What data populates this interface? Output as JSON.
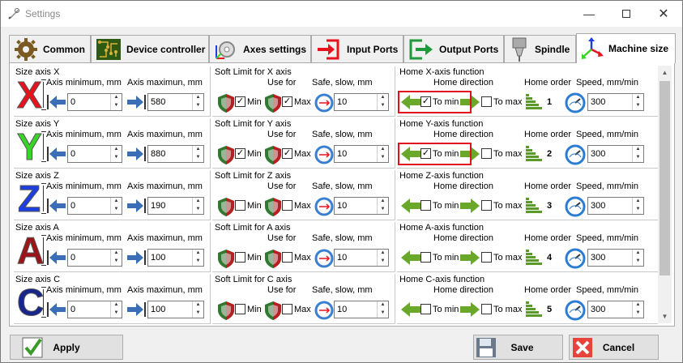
{
  "window": {
    "title": "Settings"
  },
  "tabs": [
    {
      "label": "Common"
    },
    {
      "label": "Device controller"
    },
    {
      "label": "Axes settings"
    },
    {
      "label": "Input Ports"
    },
    {
      "label": "Output Ports"
    },
    {
      "label": "Spindle"
    },
    {
      "label": "Machine size"
    }
  ],
  "labels": {
    "axis_min": "Axis minimum, mm",
    "axis_max": "Axis maximun, mm",
    "use_for": "Use for",
    "safe": "Safe, slow, mm",
    "min": "Min",
    "max": "Max",
    "home_dir": "Home direction",
    "to_min": "To min",
    "to_max": "To max",
    "home_order": "Home order",
    "speed": "Speed, mm/min"
  },
  "axes": [
    {
      "letter": "X",
      "color": "#e8121f",
      "size_title": "Size axis X",
      "soft_title": "Soft Limit for X axis",
      "home_title": "Home X-axis function",
      "min": "0",
      "max": "580",
      "soft_min": true,
      "soft_max": true,
      "safe": "10",
      "to_min": true,
      "to_max": false,
      "order": "1",
      "speed": "300"
    },
    {
      "letter": "Y",
      "color": "#39d42a",
      "size_title": "Size axis Y",
      "soft_title": "Soft Limit for Y axis",
      "home_title": "Home Y-axis function",
      "min": "0",
      "max": "880",
      "soft_min": true,
      "soft_max": true,
      "safe": "10",
      "to_min": true,
      "to_max": false,
      "order": "2",
      "speed": "300"
    },
    {
      "letter": "Z",
      "color": "#1d3ee0",
      "size_title": "Size axis Z",
      "soft_title": "Soft Limit for Z axis",
      "home_title": "Home Z-axis function",
      "min": "0",
      "max": "190",
      "soft_min": false,
      "soft_max": false,
      "safe": "10",
      "to_min": false,
      "to_max": false,
      "order": "3",
      "speed": "300"
    },
    {
      "letter": "A",
      "color": "#9a1418",
      "size_title": "Size axis A",
      "soft_title": "Soft Limit for A axis",
      "home_title": "Home A-axis function",
      "min": "0",
      "max": "100",
      "soft_min": false,
      "soft_max": false,
      "safe": "10",
      "to_min": false,
      "to_max": false,
      "order": "4",
      "speed": "300"
    },
    {
      "letter": "C",
      "color": "#17258c",
      "size_title": "Size axis C",
      "soft_title": "Soft Limit for C axis",
      "home_title": "Home C-axis function",
      "min": "0",
      "max": "100",
      "soft_min": false,
      "soft_max": false,
      "safe": "10",
      "to_min": false,
      "to_max": false,
      "order": "5",
      "speed": "300"
    }
  ],
  "buttons": {
    "apply": "Apply",
    "save": "Save",
    "cancel": "Cancel"
  }
}
